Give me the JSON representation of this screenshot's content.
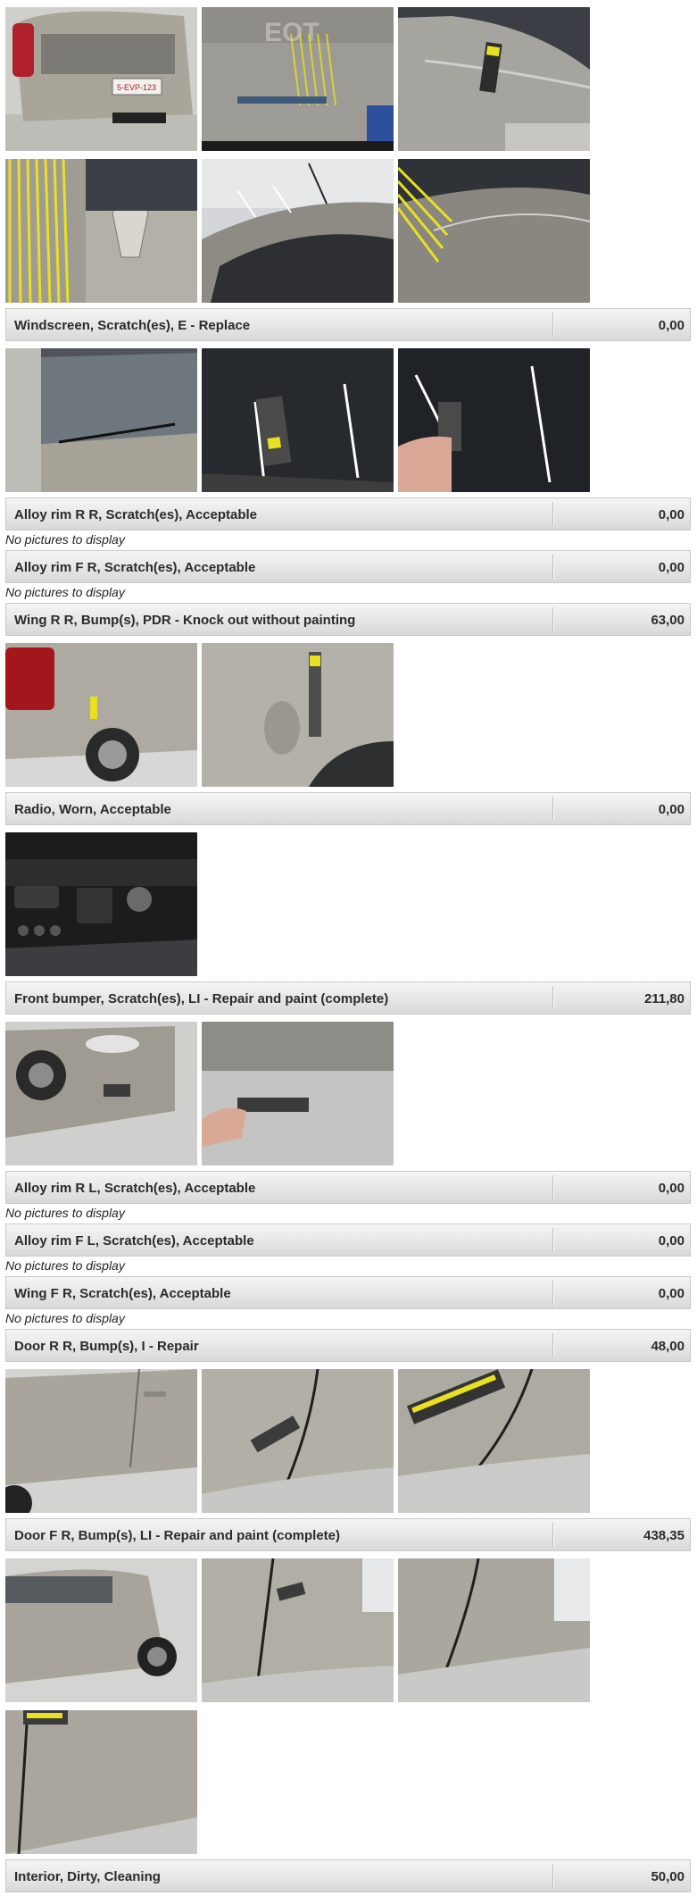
{
  "no_pictures_text": "No pictures to display",
  "items": [
    {
      "label": "Windscreen, Scratch(es), E - Replace",
      "price": "0,00"
    },
    {
      "label": "Alloy rim R R, Scratch(es), Acceptable",
      "price": "0,00"
    },
    {
      "label": "Alloy rim F R, Scratch(es), Acceptable",
      "price": "0,00"
    },
    {
      "label": "Wing R R, Bump(s), PDR - Knock out without painting",
      "price": "63,00"
    },
    {
      "label": "Radio, Worn, Acceptable",
      "price": "0,00"
    },
    {
      "label": "Front bumper, Scratch(es), LI - Repair and paint (complete)",
      "price": "211,80"
    },
    {
      "label": "Alloy rim R L, Scratch(es), Acceptable",
      "price": "0,00"
    },
    {
      "label": "Alloy rim F L, Scratch(es), Acceptable",
      "price": "0,00"
    },
    {
      "label": "Wing F R, Scratch(es), Acceptable",
      "price": "0,00"
    },
    {
      "label": "Door R R, Bump(s), I - Repair",
      "price": "48,00"
    },
    {
      "label": "Door F R, Bump(s), LI - Repair and paint (complete)",
      "price": "438,35"
    },
    {
      "label": "Interior, Dirty, Cleaning",
      "price": "50,00"
    }
  ],
  "plate_text": "5-EVP-123",
  "photo_logo_text": "EOT",
  "colors": {
    "bar_text": "#2b2b2b",
    "car_body": "#a9a59b",
    "pdr_yellow": "#e8e020"
  }
}
